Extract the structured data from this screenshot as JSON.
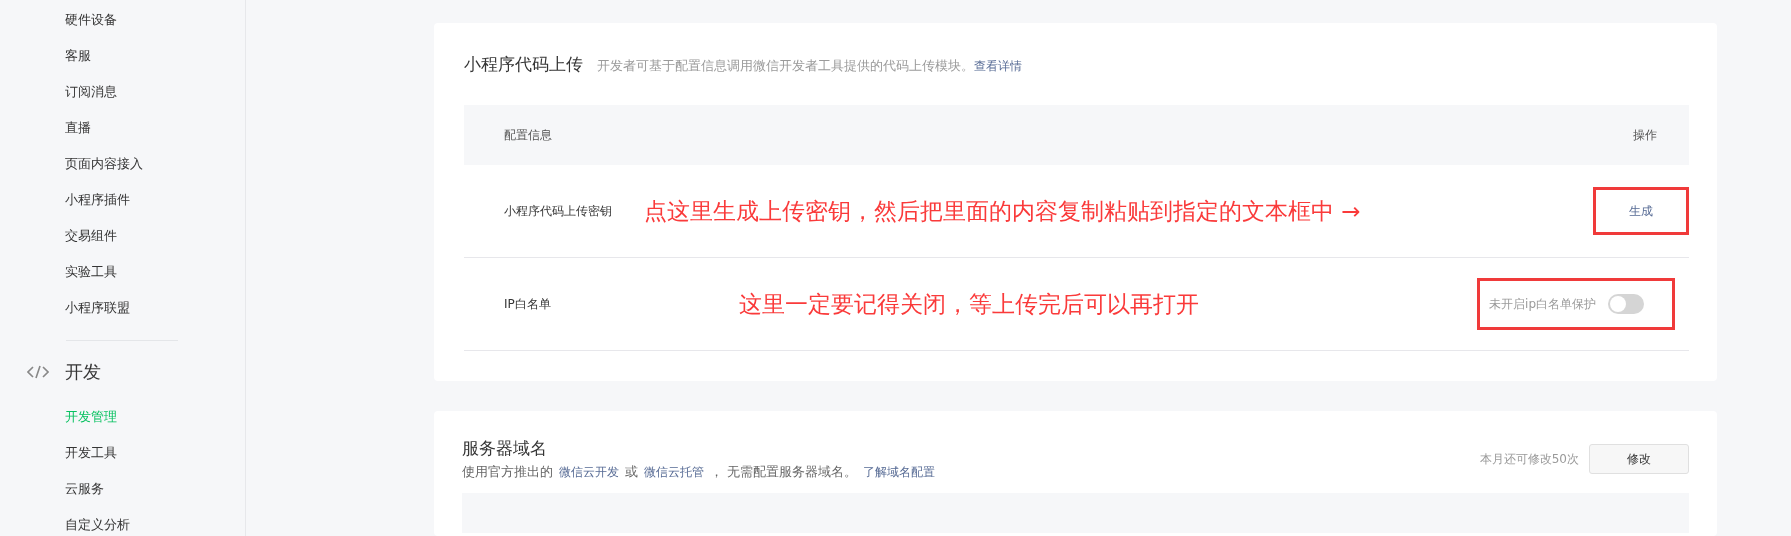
{
  "sidebar": {
    "items_above": [
      {
        "label": "硬件设备",
        "selected": false
      },
      {
        "label": "客服",
        "selected": false
      },
      {
        "label": "订阅消息",
        "selected": false
      },
      {
        "label": "直播",
        "selected": false
      },
      {
        "label": "页面内容接入",
        "selected": false
      },
      {
        "label": "小程序插件",
        "selected": false
      },
      {
        "label": "交易组件",
        "selected": false
      },
      {
        "label": "实验工具",
        "selected": false
      },
      {
        "label": "小程序联盟",
        "selected": false
      }
    ],
    "section": {
      "title": "开发",
      "items": [
        {
          "label": "开发管理",
          "selected": true
        },
        {
          "label": "开发工具",
          "selected": false
        },
        {
          "label": "云服务",
          "selected": false
        },
        {
          "label": "自定义分析",
          "selected": false
        }
      ]
    }
  },
  "upload_card": {
    "title": "小程序代码上传",
    "description": "开发者可基于配置信息调用微信开发者工具提供的代码上传模块。",
    "link": "查看详情",
    "table": {
      "columns": [
        "配置信息",
        "操作"
      ],
      "rows": [
        {
          "kind": "action",
          "label": "小程序代码上传密钥",
          "annotation": "点这里生成上传密钥，然后把里面的内容复制粘贴到指定的文本框中 →",
          "action": "生成",
          "highlighted": true
        },
        {
          "kind": "switch",
          "label": "IP白名单",
          "annotation": "这里一定要记得关闭，等上传完后可以再打开",
          "switch_label": "未开启ip白名单保护",
          "on": false,
          "highlighted": true
        }
      ]
    }
  },
  "domain_card": {
    "title": "服务器域名",
    "description_parts": [
      {
        "kind": "text",
        "text": "使用官方推出的"
      },
      {
        "kind": "link",
        "text": "微信云开发"
      },
      {
        "kind": "text",
        "text": "或"
      },
      {
        "kind": "link",
        "text": "微信云托管"
      },
      {
        "kind": "text",
        "text": "，  无需配置服务器域名。"
      },
      {
        "kind": "link",
        "text": "了解域名配置"
      }
    ],
    "quota": "本月还可修改50次",
    "button": "修改"
  }
}
